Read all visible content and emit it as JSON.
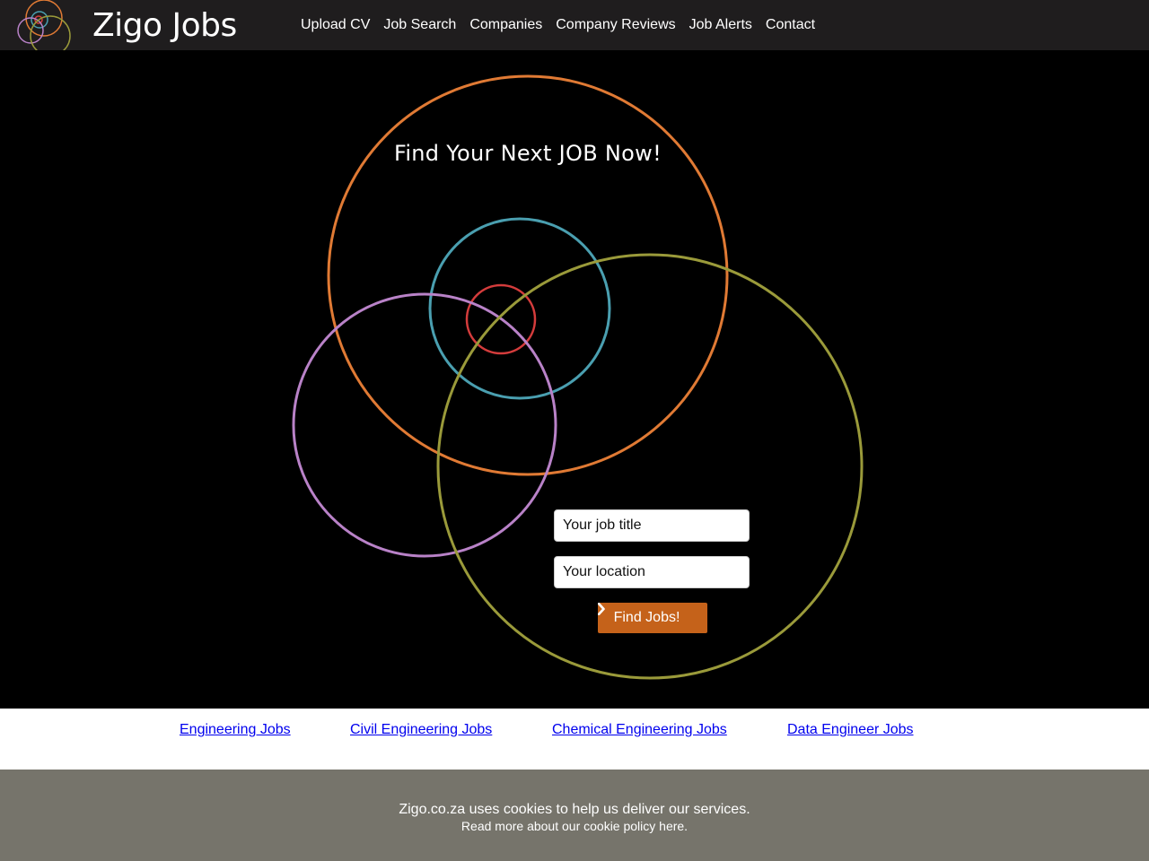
{
  "navbar": {
    "brand": "Zigo Jobs",
    "logo_icon": "venn-circles-logo-icon",
    "links": [
      "Upload CV",
      "Job Search",
      "Companies",
      "Company Reviews",
      "Job Alerts",
      "Contact"
    ]
  },
  "hero": {
    "headline": "Find Your Next JOB Now!",
    "job_title_placeholder": "Your job title",
    "location_placeholder": "Your location",
    "find_button_label": "Find Jobs!",
    "find_button_icon": "chevron-right-icon",
    "circle_colors": [
      "#e07a34",
      "#4a9fb0",
      "#d43c3c",
      "#b982c8",
      "#9a9a3a"
    ]
  },
  "seo_links": [
    "Engineering Jobs",
    "Civil Engineering Jobs",
    "Chemical Engineering Jobs",
    "Data Engineer Jobs"
  ],
  "cookie": {
    "line1": "Zigo.co.za uses cookies to help us deliver our services.",
    "line2_prefix": "Read more about our ",
    "line2_link": "cookie policy here."
  },
  "colors": {
    "navbar_bg": "#1f1d1e",
    "hero_bg": "#000000",
    "button_bg": "#c5621a",
    "cookie_bg": "#76746b",
    "link": "#0000ee"
  }
}
